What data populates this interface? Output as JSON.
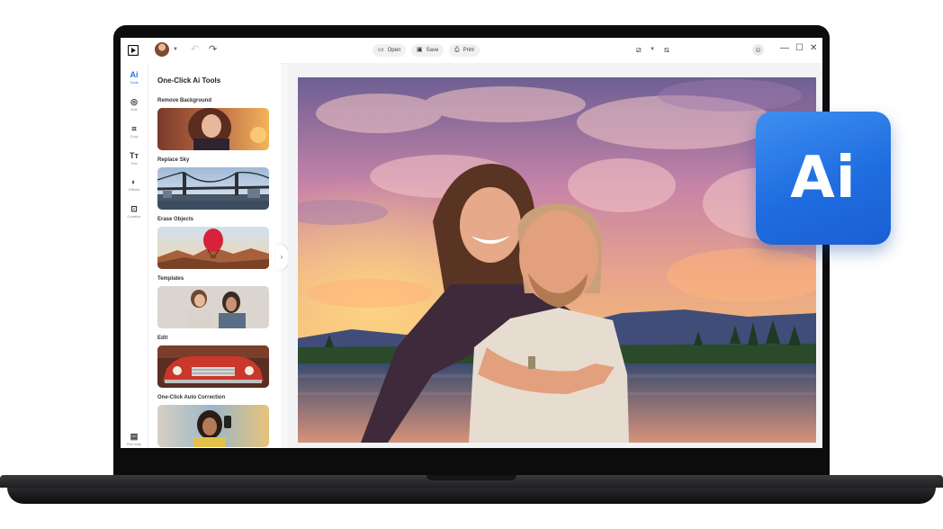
{
  "toolbar": {
    "open_label": "Open",
    "save_label": "Save",
    "print_label": "Print"
  },
  "rail": {
    "items": [
      {
        "glyph": "Ai",
        "label": "Tools",
        "icon": "ai-icon"
      },
      {
        "glyph": "◎",
        "label": "Edit",
        "icon": "edit-icon"
      },
      {
        "glyph": "⌗",
        "label": "Crop",
        "icon": "crop-icon"
      },
      {
        "glyph": "Tт",
        "label": "Text",
        "icon": "text-icon"
      },
      {
        "glyph": "◐",
        "label": "Effects",
        "icon": "effects-icon"
      },
      {
        "glyph": "⊡",
        "label": "Creative",
        "icon": "creative-icon"
      }
    ],
    "bottom": {
      "glyph": "▤",
      "label": "Film strip",
      "icon": "filmstrip-icon"
    }
  },
  "panel": {
    "title": "One-Click Ai Tools",
    "tools": [
      {
        "label": "Remove Background"
      },
      {
        "label": "Replace Sky"
      },
      {
        "label": "Erase Objects"
      },
      {
        "label": "Templates"
      },
      {
        "label": "Edit"
      },
      {
        "label": "One-Click Auto Correction"
      }
    ]
  },
  "badge": {
    "text": "Ai"
  },
  "colors": {
    "accent": "#2a6fe8",
    "badge": "#1f6de0"
  }
}
